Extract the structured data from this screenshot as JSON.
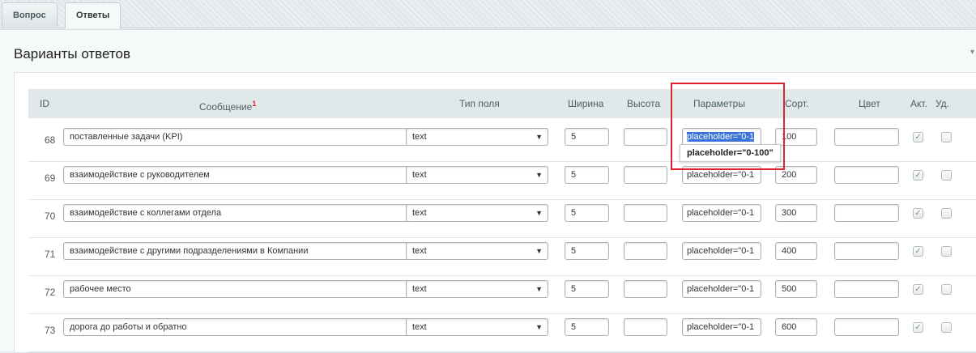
{
  "tabs": [
    {
      "label": "Вопрос",
      "active": false
    },
    {
      "label": "Ответы",
      "active": true
    }
  ],
  "section_title": "Варианты ответов",
  "columns": {
    "id": "ID",
    "message": "Сообщение",
    "message_sup": "1",
    "field_type": "Тип поля",
    "width": "Ширина",
    "height": "Высота",
    "params": "Параметры",
    "sort": "Сорт.",
    "color": "Цвет",
    "active": "Акт.",
    "delete": "Уд."
  },
  "rows": [
    {
      "id": "68",
      "message": "поставленные задачи (KPI)",
      "type": "text",
      "width": "5",
      "height": "",
      "params": "placeholder=\"0-1",
      "sort": "100",
      "color": "",
      "active": true,
      "delete": false,
      "params_selected": true
    },
    {
      "id": "69",
      "message": "взаимодействие с руководителем",
      "type": "text",
      "width": "5",
      "height": "",
      "params": "placeholder=\"0-1",
      "sort": "200",
      "color": "",
      "active": true,
      "delete": false
    },
    {
      "id": "70",
      "message": "взаимодействие с коллегами отдела",
      "type": "text",
      "width": "5",
      "height": "",
      "params": "placeholder=\"0-1",
      "sort": "300",
      "color": "",
      "active": true,
      "delete": false
    },
    {
      "id": "71",
      "message": "взаимодействие с другими подразделениями в Компании",
      "type": "text",
      "width": "5",
      "height": "",
      "params": "placeholder=\"0-1",
      "sort": "400",
      "color": "",
      "active": true,
      "delete": false
    },
    {
      "id": "72",
      "message": "рабочее место",
      "type": "text",
      "width": "5",
      "height": "",
      "params": "placeholder=\"0-1",
      "sort": "500",
      "color": "",
      "active": true,
      "delete": false
    },
    {
      "id": "73",
      "message": "дорога до работы и обратно",
      "type": "text",
      "width": "5",
      "height": "",
      "params": "placeholder=\"0-1",
      "sort": "600",
      "color": "",
      "active": true,
      "delete": false
    }
  ],
  "tooltip": "placeholder=\"0-100\"",
  "colors": {
    "highlight": "#e2232f",
    "selection": "#3b74d8"
  }
}
